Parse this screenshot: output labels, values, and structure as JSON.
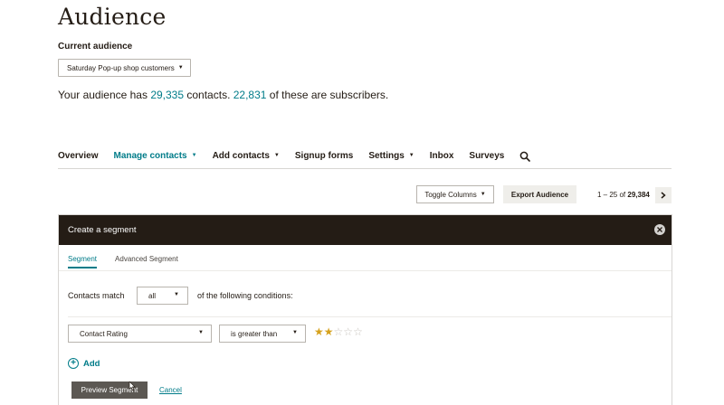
{
  "header": {
    "title": "Audience",
    "current_audience_label": "Current audience",
    "audience_select": "Saturday Pop-up shop customers"
  },
  "summary": {
    "prefix": "Your audience has",
    "contacts": "29,335",
    "middle": "contacts.",
    "subscribers": "22,831",
    "suffix": "of these are subscribers."
  },
  "nav": {
    "items": [
      {
        "label": "Overview",
        "dropdown": false,
        "active": false
      },
      {
        "label": "Manage contacts",
        "dropdown": true,
        "active": true
      },
      {
        "label": "Add contacts",
        "dropdown": true,
        "active": false
      },
      {
        "label": "Signup forms",
        "dropdown": false,
        "active": false
      },
      {
        "label": "Settings",
        "dropdown": true,
        "active": false
      },
      {
        "label": "Inbox",
        "dropdown": false,
        "active": false
      },
      {
        "label": "Surveys",
        "dropdown": false,
        "active": false
      }
    ],
    "search_icon": "search-icon"
  },
  "toolbar": {
    "toggle_columns": "Toggle Columns",
    "export": "Export Audience",
    "pagination_range": "1 – 25",
    "pagination_of": "of",
    "pagination_total": "29,384"
  },
  "segment": {
    "title": "Create a segment",
    "tabs": [
      {
        "label": "Segment",
        "active": true
      },
      {
        "label": "Advanced Segment",
        "active": false
      }
    ],
    "match_prefix": "Contacts match",
    "match_value": "all",
    "match_suffix": "of the following conditions:",
    "condition": {
      "field": "Contact Rating",
      "operator": "is greater than",
      "rating": 2,
      "rating_max": 5
    },
    "add_label": "Add",
    "preview_label": "Preview Segment",
    "cancel_label": "Cancel"
  },
  "colors": {
    "accent": "#007c89",
    "dark": "#241c15",
    "star": "#d6a21e"
  }
}
